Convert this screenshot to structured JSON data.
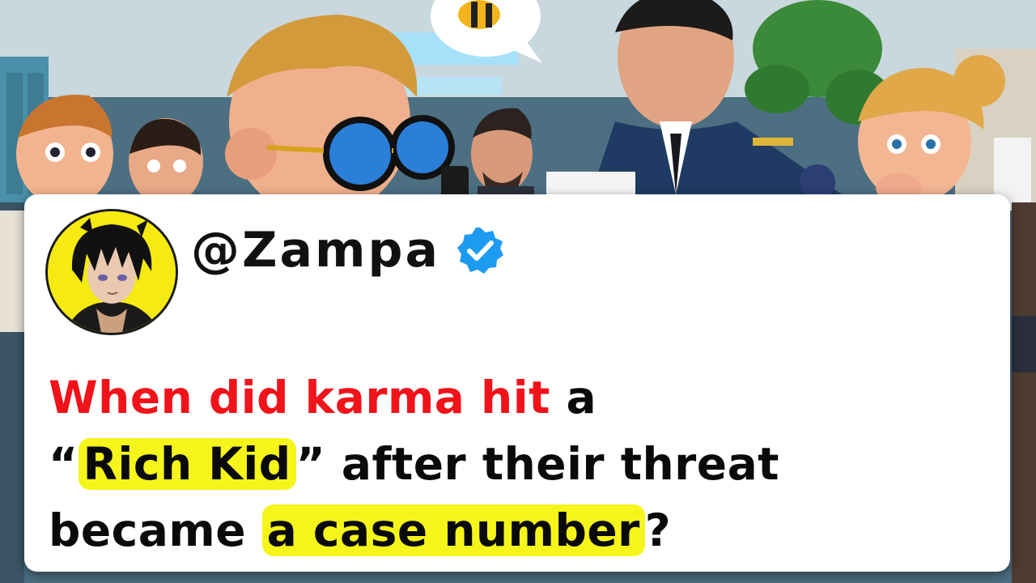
{
  "post": {
    "handle": "@Zampa",
    "verified_icon": "verified-badge-icon",
    "avatar_icon": "anime-avatar-icon",
    "question": {
      "line1": {
        "red": "When did karma hit",
        "rest": " a"
      },
      "line2": {
        "open_quote": "“",
        "highlight": "Rich Kid",
        "close_quote": "”",
        "rest": " after their threat"
      },
      "line3": {
        "lead": "became ",
        "highlight": "a case number",
        "end": "?"
      }
    }
  },
  "colors": {
    "red_text": "#f0131a",
    "highlight": "#f5f51c",
    "badge_blue": "#1d9bf0",
    "avatar_bg": "#f5ea12"
  }
}
